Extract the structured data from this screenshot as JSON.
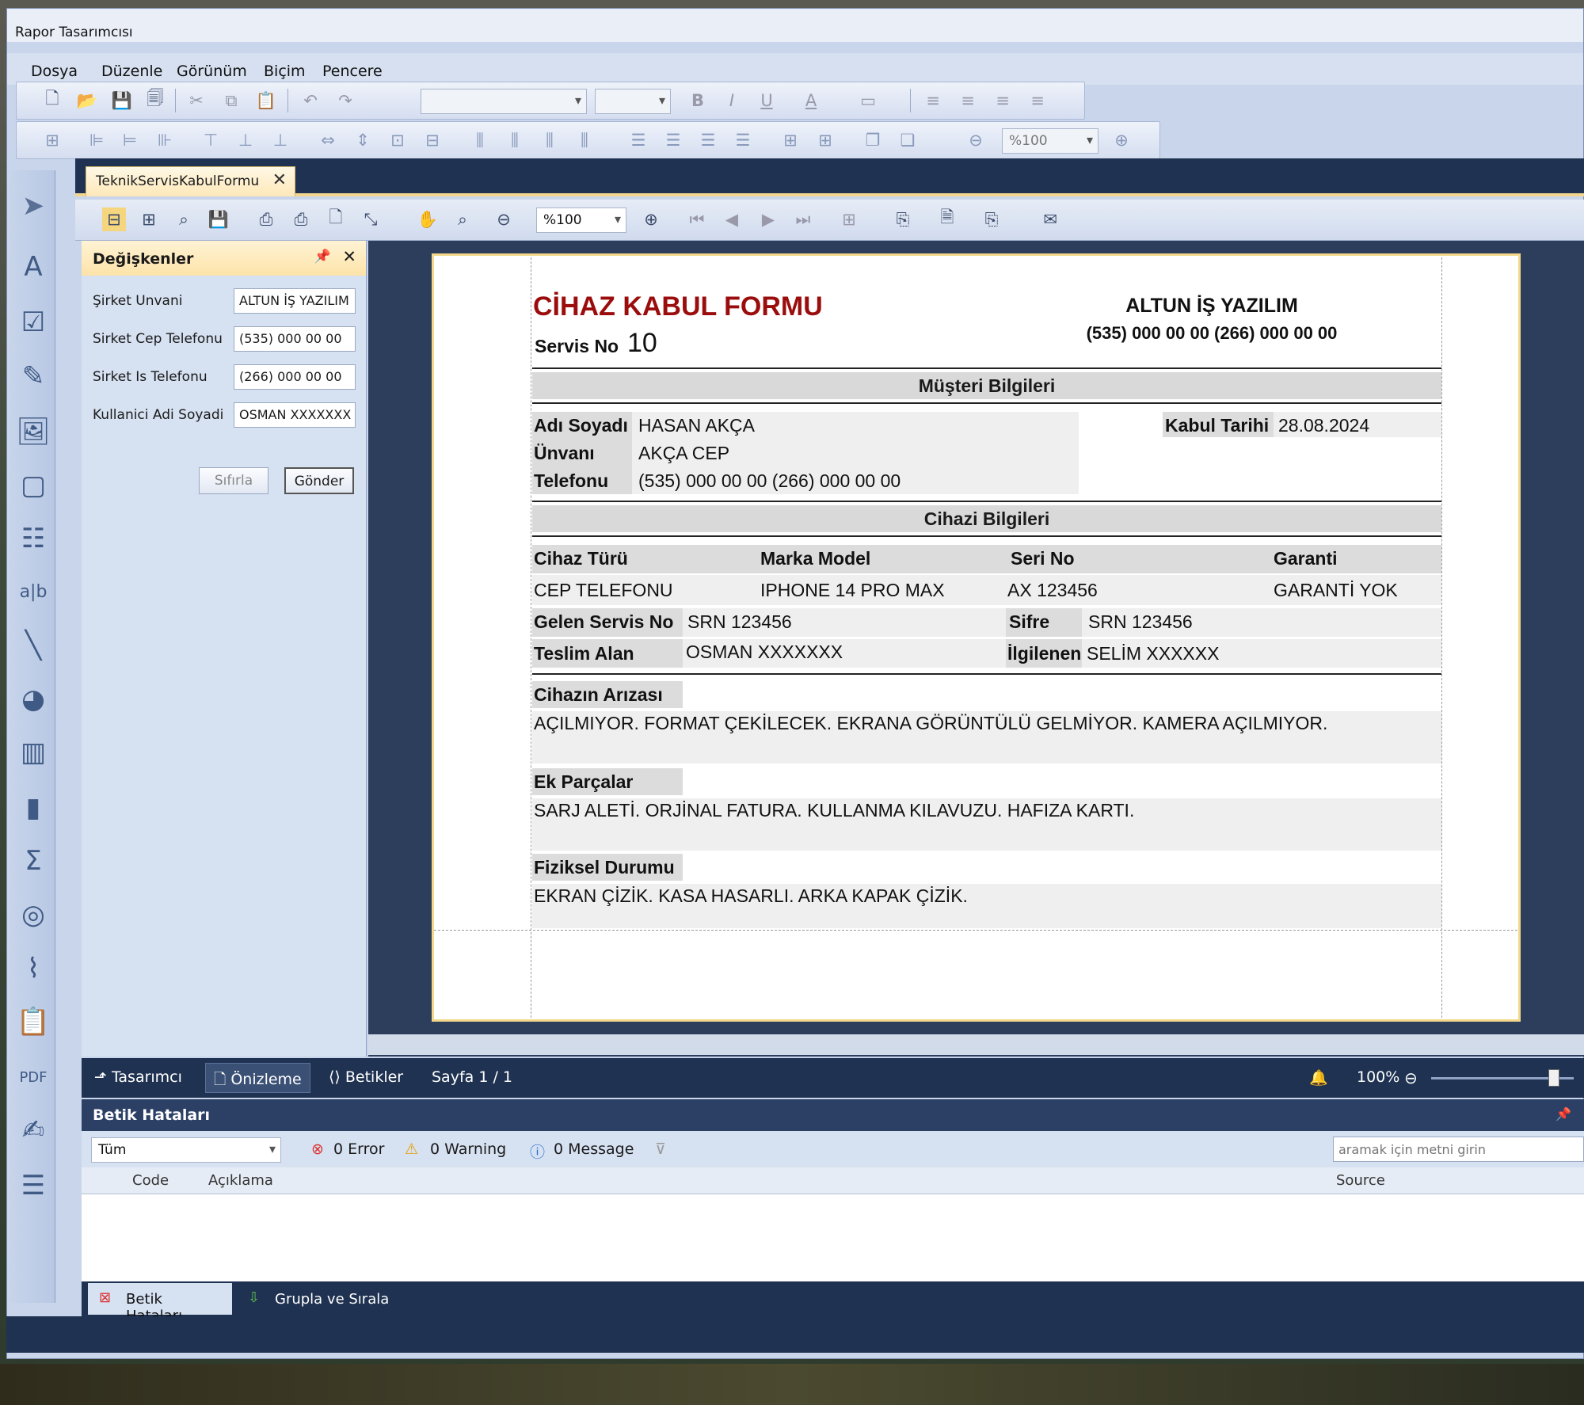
{
  "app": {
    "title": "Rapor Tasarımcısı"
  },
  "menu": [
    "Dosya",
    "Düzenle",
    "Görünüm",
    "Biçim",
    "Pencere"
  ],
  "toolbar": {
    "zoom": "%100"
  },
  "document_tab": {
    "label": "TeknikServisKabulFormu"
  },
  "preview_toolbar": {
    "zoom": "%100"
  },
  "variables_panel": {
    "title": "Değişkenler",
    "rows": [
      {
        "label": "Şirket Unvani",
        "value": "ALTUN İŞ YAZILIM"
      },
      {
        "label": "Sirket Cep Telefonu",
        "value": "(535) 000 00 00"
      },
      {
        "label": "Sirket Is Telefonu",
        "value": "(266) 000 00 00"
      },
      {
        "label": "Kullanici Adi Soyadi",
        "value": "OSMAN XXXXXXX"
      }
    ],
    "reset_label": "Sıfırla",
    "submit_label": "Gönder"
  },
  "report": {
    "title": "CİHAZ KABUL FORMU",
    "service_no_label": "Servis No",
    "service_no": "10",
    "company_name": "ALTUN İŞ YAZILIM",
    "company_phones": "(535) 000 00 00 (266) 000 00 00",
    "customer_band": "Müşteri Bilgileri",
    "name_label": "Adı Soyadı",
    "name_value": "HASAN AKÇA",
    "title_label": "Ünvanı",
    "title_value": "AKÇA CEP",
    "phone_label": "Telefonu",
    "phone_value": "(535) 000 00 00 (266) 000 00 00",
    "accept_date_label": "Kabul Tarihi",
    "accept_date_value": "28.08.2024",
    "device_band": "Cihazi Bilgileri",
    "device_type_label": "Cihaz Türü",
    "device_type_value": "CEP TELEFONU",
    "brand_label": "Marka Model",
    "brand_value": "IPHONE 14 PRO MAX",
    "serial_label": "Seri No",
    "serial_value": "AX 123456",
    "warranty_label": "Garanti",
    "warranty_value": "GARANTİ YOK",
    "incoming_label": "Gelen Servis No",
    "incoming_value": "SRN 123456",
    "password_label": "Sifre",
    "password_value": "SRN 123456",
    "receiver_label": "Teslim Alan",
    "receiver_value": "OSMAN XXXXXXX",
    "related_label": "İlgilenen",
    "related_value": "SELİM XXXXXX",
    "fault_label": "Cihazın Arızası",
    "fault_value": "AÇILMIYOR. FORMAT ÇEKİLECEK. EKRANA GÖRÜNTÜLÜ GELMİYOR. KAMERA AÇILMIYOR.",
    "parts_label": "Ek Parçalar",
    "parts_value": "SARJ ALETİ. ORJİNAL FATURA. KULLANMA KILAVUZU. HAFIZA KARTI.",
    "physical_label": "Fiziksel Durumu",
    "physical_value": "EKRAN ÇİZİK. KASA HASARLI. ARKA KAPAK ÇİZİK."
  },
  "statusbar": {
    "designer": "Tasarımcı",
    "preview": "Önizleme",
    "scripts": "Betikler",
    "page": "Sayfa 1 / 1",
    "zoom": "100%",
    "zoom_level": 0.86
  },
  "errors_panel": {
    "title": "Betik Hataları",
    "filter": "Tüm",
    "errors": "0 Error",
    "warnings": "0 Warning",
    "messages": "0 Message",
    "search_placeholder": "aramak için metni girin",
    "columns": [
      "Code",
      "Açıklama",
      "Source"
    ]
  },
  "bottom_tabs": [
    "Betik Hataları",
    "Grupla ve Sırala"
  ]
}
